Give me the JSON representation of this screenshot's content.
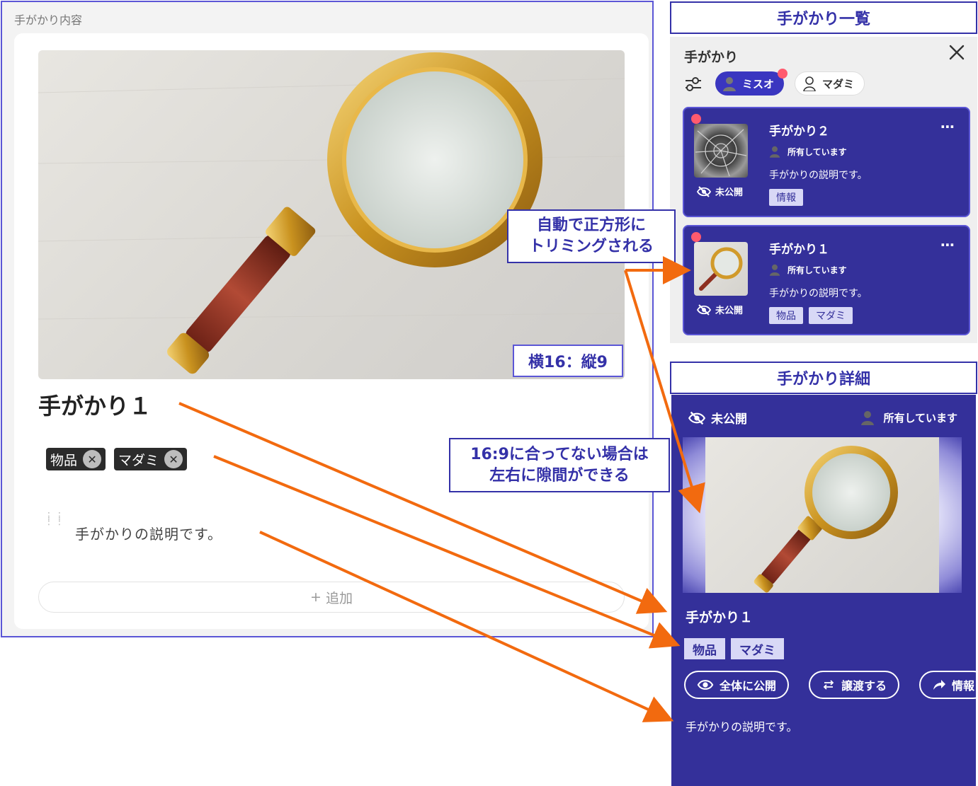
{
  "editor": {
    "header": "手がかり内容",
    "ratio_label": "横16：縦9",
    "title": "手がかり１",
    "tags": [
      "物品",
      "マダミ"
    ],
    "description": "手がかりの説明です。",
    "add_label": "追加"
  },
  "list_heading": "手がかり一覧",
  "detail_heading": "手がかり詳細",
  "list": {
    "title": "手がかり",
    "chips": [
      {
        "label": "ミスオ",
        "selected": true
      },
      {
        "label": "マダミ",
        "selected": false
      }
    ],
    "cards": [
      {
        "title": "手がかり２",
        "owner": "所有しています",
        "description": "手がかりの説明です。",
        "private_label": "未公開",
        "tags": [
          "情報"
        ]
      },
      {
        "title": "手がかり１",
        "owner": "所有しています",
        "description": "手がかりの説明です。",
        "private_label": "未公開",
        "tags": [
          "物品",
          "マダミ"
        ]
      }
    ]
  },
  "callouts": {
    "square_line1": "自動で正方形に",
    "square_line2": "トリミングされる",
    "gap_line1": "16:9に合ってない場合は",
    "gap_line2": "左右に隙間ができる"
  },
  "detail": {
    "private_label": "未公開",
    "owner": "所有しています",
    "title": "手がかり１",
    "tags": [
      "物品",
      "マダミ"
    ],
    "actions": [
      "全体に公開",
      "譲渡する",
      "情報"
    ],
    "description": "手がかりの説明です。"
  },
  "colors": {
    "accent": "#34309a",
    "border": "#3431a8",
    "arrow": "#f26a0f",
    "notify": "#ff5a6e"
  }
}
